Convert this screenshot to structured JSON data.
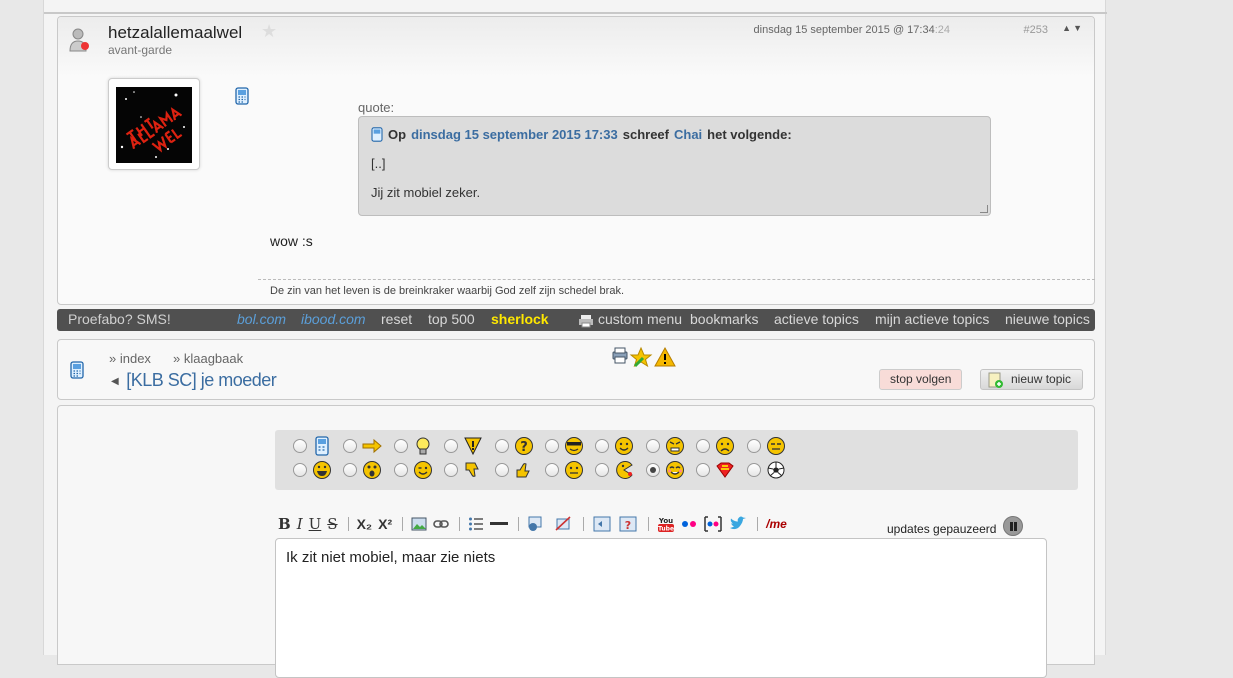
{
  "post": {
    "username": "hetzalallemaalwel",
    "user_title": "avant-garde",
    "date": "dinsdag 15 september 2015 @ 17:34",
    "date_seconds": ":24",
    "post_number": "#253",
    "avatar_text": "HET ZAL ALLEMAAL WEL",
    "quote_label": "quote:",
    "quote_prefix": "Op",
    "quote_date": "dinsdag 15 september 2015 17:33",
    "quote_mid": "schreef",
    "quote_author": "Chai",
    "quote_suffix": "het volgende:",
    "quote_line1": "[..]",
    "quote_line2": "Jij zit mobiel zeker.",
    "body": "wow :s",
    "signature": "De zin van het leven is de breinkraker waarbij God zelf zijn schedel brak."
  },
  "navbar": {
    "promo": "Proefabo? SMS!",
    "items": [
      "bol.com",
      "ibood.com",
      "reset",
      "top 500",
      "sherlock",
      "custom menu",
      "bookmarks",
      "actieve topics",
      "mijn actieve topics",
      "nieuwe topics"
    ]
  },
  "topic": {
    "crumb1": "» index",
    "crumb2": "» klaagbaak",
    "title": "[KLB SC] je moeder",
    "unfollow_label": "stop volgen",
    "new_topic_label": "nieuw topic"
  },
  "reply": {
    "icons_row1": [
      "phone-icon",
      "arrow-icon",
      "lightbulb-icon",
      "warning-icon",
      "question-icon",
      "cool-smiley-icon",
      "smiley-icon",
      "angry-icon",
      "sad-icon",
      "bored-icon"
    ],
    "icons_row2": [
      "grin-icon",
      "surprised-icon",
      "wink-icon",
      "thumbs-down-icon",
      "thumbs-up-icon",
      "neutral-icon",
      "pacman-icon",
      "happy-icon",
      "superman-icon",
      "soccer-ball-icon"
    ],
    "selected_icon": "happy-icon",
    "toolbar": {
      "bold": "B",
      "italic": "I",
      "underline": "U",
      "strike": "S",
      "subscript": "X₂",
      "superscript": "X²",
      "me": "/me"
    },
    "updates_label": "updates gepauzeerd",
    "editor_text": "Ik zit niet mobiel, maar zie niets"
  },
  "colors": {
    "link": "#3b6da1",
    "highlight": "#ffe800",
    "navbar_bg": "#505050"
  }
}
